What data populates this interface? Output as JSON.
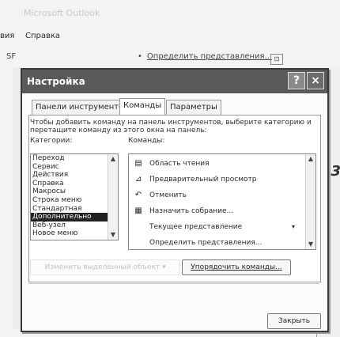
{
  "app": {
    "window_title": "Microsoft Outlook",
    "menu": [
      "вия",
      "Справка"
    ],
    "toolbar_left_char": "SF",
    "toolbar_define_bullet": "•",
    "toolbar_define_text": "Определить представления...",
    "toolbar_box": "⊡"
  },
  "side_digit": "3",
  "dialog": {
    "title": "Настройка",
    "help_button": "?",
    "close_button": "×",
    "tabs": [
      {
        "label": "Панели инструментов"
      },
      {
        "label": "Команды"
      },
      {
        "label": "Параметры"
      }
    ],
    "instruction": "Чтобы добавить команду на панель инструментов, выберите категорию и перетащите команду из этого окна на панель:",
    "categories_label": "Категории:",
    "commands_label": "Команды:",
    "categories": [
      "Переход",
      "Сервис",
      "Действия",
      "Справка",
      "Макросы",
      "Строка меню",
      "Стандартная",
      "Дополнительно",
      "Веб-узел",
      "Новое меню"
    ],
    "selected_category": "Дополнительно",
    "commands": [
      {
        "icon": "▤",
        "icon_name": "reading-pane-icon",
        "label": "Область чтения",
        "arrow": ""
      },
      {
        "icon": "⊿",
        "icon_name": "preview-icon",
        "label": "Предварительный просмотр",
        "arrow": ""
      },
      {
        "icon": "↶",
        "icon_name": "undo-icon",
        "label": "Отменить",
        "arrow": ""
      },
      {
        "icon": "▦",
        "icon_name": "meeting-icon",
        "label": "Назначить собрание...",
        "arrow": ""
      },
      {
        "icon": "",
        "icon_name": "",
        "label": "Текущее представление",
        "arrow": "▾"
      },
      {
        "icon": "",
        "icon_name": "",
        "label": "Определить представления...",
        "arrow": ""
      }
    ],
    "modify_selection_label": "Изменить выделенный объект ▾",
    "rearrange_label": "Упорядочить команды...",
    "close_label": "Закрыть",
    "scroll_up": "▲",
    "scroll_down": "▼"
  }
}
